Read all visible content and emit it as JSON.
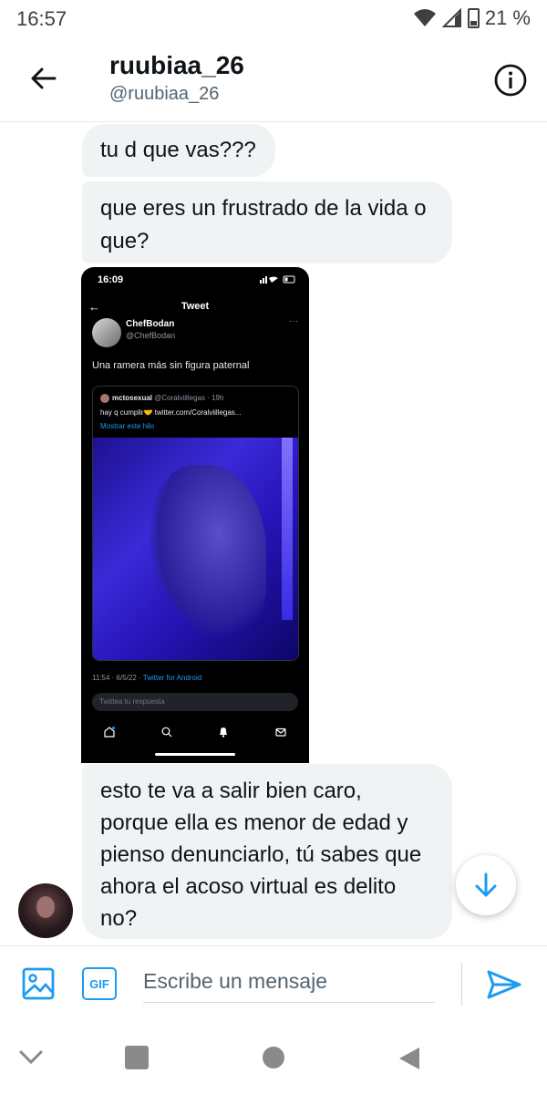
{
  "status_bar": {
    "time": "16:57",
    "battery": "21 %"
  },
  "header": {
    "title": "ruubiaa_26",
    "handle": "@ruubiaa_26"
  },
  "messages": [
    {
      "text": "tu d que vas???"
    },
    {
      "text": "que eres un frustrado de la vida o que?"
    },
    {
      "text": "esto te va a salir bien caro, porque ella es menor de edad y pienso denunciarlo, tú sabes que ahora el acoso virtual es delito no?"
    }
  ],
  "embedded_screenshot": {
    "time": "16:09",
    "header": "Tweet",
    "author_name": "ChefBodan",
    "author_handle": "@ChefBodan",
    "tweet_text": "Una ramera más sin figura paternal",
    "quoted": {
      "author": "mctosexual",
      "handle_time": "@Coralviillegas · 19h",
      "text": "hay q cumplir🤝 twitter.com/Coralviillegas...",
      "link": "Mostrar este hilo"
    },
    "meta_date": "11:54 · 6/5/22 · ",
    "meta_source": "Twitter for Android",
    "reply_placeholder": "Twittea tu respuesta"
  },
  "composer": {
    "gif_label": "GIF",
    "placeholder": "Escribe un mensaje"
  },
  "colors": {
    "accent": "#1d9bf0",
    "bubble": "#eff3f4",
    "text": "#0f1419",
    "secondary": "#536471"
  }
}
